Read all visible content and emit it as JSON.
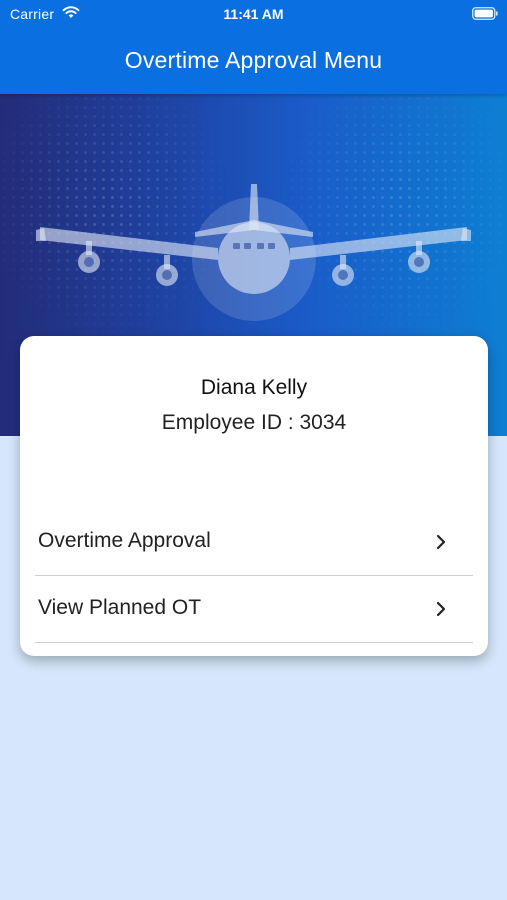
{
  "status_bar": {
    "carrier": "Carrier",
    "time": "11:41 AM",
    "wifi_icon": "wifi-icon",
    "battery_icon": "battery-full-icon"
  },
  "nav": {
    "title": "Overtime Approval Menu"
  },
  "hero": {
    "image": "airplane-icon"
  },
  "profile": {
    "name": "Diana Kelly",
    "employee_id_label": "Employee ID : 3034"
  },
  "menu": [
    {
      "label": "Overtime Approval",
      "icon": "chevron-right-icon"
    },
    {
      "label": "View Planned OT",
      "icon": "chevron-right-icon"
    }
  ],
  "colors": {
    "brand_blue": "#0a6fe0",
    "hero_dark": "#232c78",
    "hero_light": "#0d7fd3",
    "background": "#d6e7fb"
  }
}
